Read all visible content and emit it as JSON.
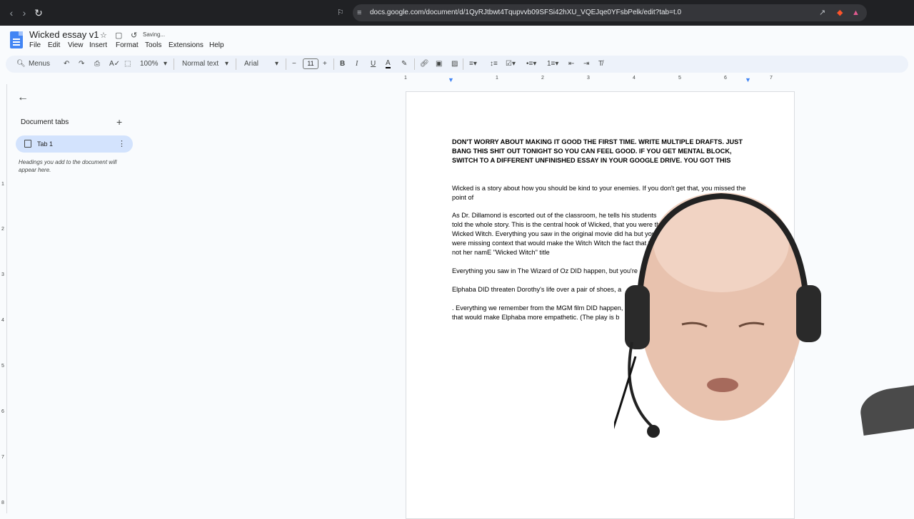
{
  "browser": {
    "url": "docs.google.com/document/d/1QyRJtbwt4Tqupvvb09SFSi42hXU_VQEJqe0YFsbPelk/edit?tab=t.0"
  },
  "header": {
    "title": "Wicked essay v1",
    "status": "Saving...",
    "menus": [
      "File",
      "Edit",
      "View",
      "Insert",
      "Format",
      "Tools",
      "Extensions",
      "Help"
    ]
  },
  "toolbar": {
    "search_label": "Menus",
    "zoom": "100%",
    "style": "Normal text",
    "font": "Arial",
    "font_size": "11"
  },
  "ruler": {
    "numbers": [
      "1",
      "1",
      "2",
      "3",
      "4",
      "5",
      "6",
      "7"
    ]
  },
  "vruler": {
    "numbers": [
      "1",
      "2",
      "3",
      "4",
      "5",
      "6",
      "7",
      "8"
    ]
  },
  "sidebar": {
    "title": "Document tabs",
    "tab_label": "Tab 1",
    "hint": "Headings you add to the document will appear here."
  },
  "document": {
    "heading": "DON'T WORRY ABOUT MAKING IT GOOD THE FIRST TIME. WRITE MULTIPLE DRAFTS. JUST BANG THIS SHIT OUT TONIGHT SO YOU CAN FEEL GOOD. IF YOU GET MENTAL BLOCK, SWITCH TO A DIFFERENT UNFINISHED ESSAY IN YOUR GOOGLE DRIVE. YOU GOT THIS",
    "p1": "Wicked is a story about how you should be kind to your enemies. If you don't get that, you missed the point of",
    "p2": "As Dr. Dillamond is escorted out of the classroom, he tells his students told the whole story. This is the central hook of Wicked, that you were the Wicked Witch. Everything you saw in the original movie did ha but you were missing context that would make the Witch Witch the fact that that's not her namE \"Wicked Witch\" title",
    "p3": " Everything you saw in The Wizard of Oz DID happen, but you're",
    "p4": "Elphaba DID threaten Dorothy's life over a pair of shoes, a",
    "p5": ". Everything we remember from the MGM film DID happen, b that would make Elphaba more empathetic. (The play is b"
  },
  "colors": {
    "accent": "#4285f4",
    "tab_active": "#d3e3fd",
    "toolbar_bg": "#edf2fa"
  }
}
